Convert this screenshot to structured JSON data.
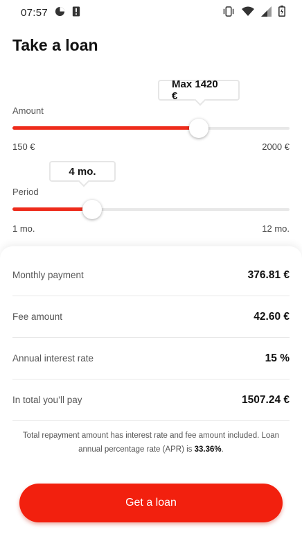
{
  "status_bar": {
    "time": "07:57"
  },
  "header": {
    "title": "Take a loan"
  },
  "amount": {
    "label": "Amount",
    "tooltip": "Max 1420 €",
    "min_label": "150 €",
    "max_label": "2000 €",
    "min": 150,
    "max": 2000,
    "value": 1420
  },
  "period": {
    "label": "Period",
    "tooltip": "4 mo.",
    "min_label": "1 mo.",
    "max_label": "12 mo.",
    "min": 1,
    "max": 12,
    "value": 4
  },
  "summary": {
    "rows": [
      {
        "label": "Monthly payment",
        "value": "376.81 €"
      },
      {
        "label": "Fee amount",
        "value": "42.60 €"
      },
      {
        "label": "Annual interest rate",
        "value": "15 %"
      },
      {
        "label": "In total you’ll pay",
        "value": "1507.24 €"
      }
    ],
    "note_text": "Total repayment amount has interest rate and fee amount included. Loan annual percentage rate (APR) is ",
    "apr": "33.36%",
    "note_end": "."
  },
  "cta": {
    "label": "Get a loan"
  },
  "colors": {
    "accent": "#f2200e",
    "slider_fill": "#ee2b1b",
    "track": "#e8e8e8"
  }
}
